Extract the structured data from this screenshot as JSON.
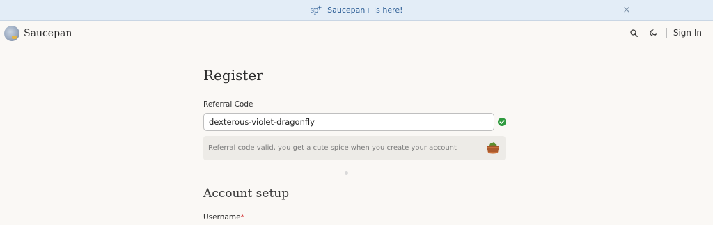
{
  "banner": {
    "logo_text": "sp",
    "message": "Saucepan+ is here!",
    "close_glyph": "×",
    "icons": {
      "close": "close-icon",
      "logo": "saucepan-plus-logo"
    }
  },
  "header": {
    "brand_name": "Saucepan",
    "sign_in_label": "Sign In",
    "icons": {
      "logo": "saucepan-logo-icon",
      "search": "search-icon",
      "theme": "moon-icon"
    }
  },
  "register": {
    "title": "Register",
    "referral_label": "Referral Code",
    "referral_value": "dexterous-violet-dragonfly",
    "valid_message": "Referral code valid, you get a cute spice when you create your account",
    "icons": {
      "valid": "check-circle-icon",
      "reward": "spice-basket-icon"
    }
  },
  "account_setup": {
    "title": "Account setup",
    "username_label": "Username",
    "required_marker": "*"
  },
  "colors": {
    "banner_bg": "#e3edf7",
    "banner_text": "#2c5d95",
    "page_bg": "#faf8f5",
    "success": "#2e9a3e",
    "required": "#d22d2d"
  }
}
